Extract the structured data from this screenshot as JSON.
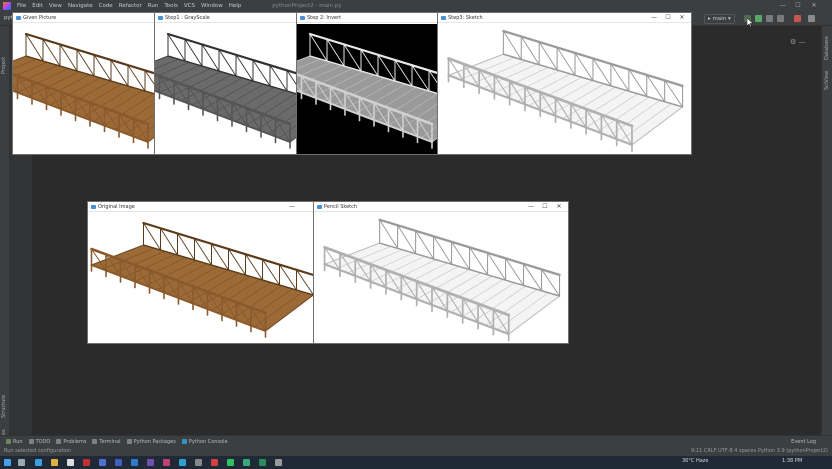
{
  "ide": {
    "menu": [
      "File",
      "Edit",
      "View",
      "Navigate",
      "Code",
      "Refactor",
      "Run",
      "Tools",
      "VCS",
      "Window",
      "Help"
    ],
    "title": "pythonProject2 - main.py",
    "project_label": "pythonP",
    "run_config": "main",
    "left_tools": [
      "Project",
      "Structure",
      "Favorites"
    ],
    "right_tools": [
      "Database",
      "SciView"
    ],
    "tool_windows": [
      "Run",
      "TODO",
      "Problems",
      "Terminal",
      "Python Packages",
      "Python Console"
    ],
    "event_log": "Event Log",
    "status_left": "Run selected configuration",
    "status_right": "9:11   CRLF   UTF-8   4 spaces   Python 3.9 (pythonProject2)",
    "taskbar_weather": "36°C  Haze",
    "taskbar_time": "1:38 PM",
    "accent": "#3592c4"
  },
  "windows": [
    {
      "title": "Given Picture",
      "style": "wood"
    },
    {
      "title": "Step1 : GrayScale",
      "style": "gray"
    },
    {
      "title": "Step 2: Invert",
      "style": "invert"
    },
    {
      "title": "Step3: Sketch",
      "style": "sketch"
    },
    {
      "title": "Original Image",
      "style": "wood"
    },
    {
      "title": "Pencil Sketch",
      "style": "sketch"
    }
  ],
  "window_controls": {
    "minimize": "—",
    "maximize": "☐",
    "close": "✕"
  }
}
